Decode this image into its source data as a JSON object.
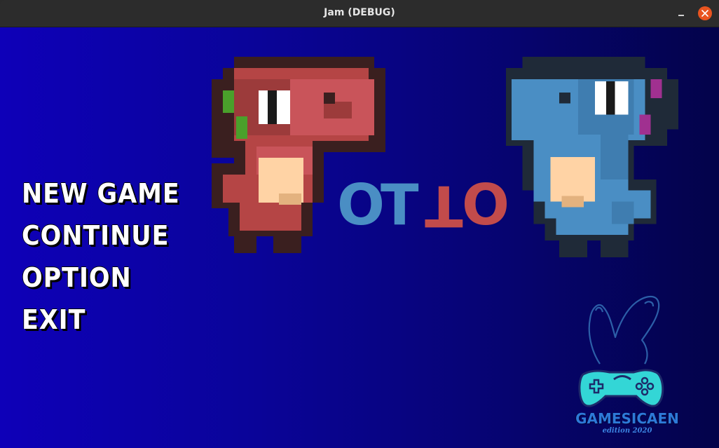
{
  "window": {
    "title": "Jam (DEBUG)",
    "minimize_icon": "minimize-icon",
    "close_icon": "close-icon",
    "close_color": "#e9541f"
  },
  "menu": {
    "items": [
      {
        "label": "NEW GAME"
      },
      {
        "label": "CONTINUE"
      },
      {
        "label": "OPTION"
      },
      {
        "label": "EXIT"
      }
    ]
  },
  "title_logo": {
    "letters": [
      {
        "char": "O",
        "color": "#4a8ec4"
      },
      {
        "char": "T",
        "color": "#4a8ec4"
      },
      {
        "char": "T",
        "color": "#c24b4b",
        "upside_down": true
      },
      {
        "char": "O",
        "color": "#c24b4b"
      }
    ]
  },
  "characters": [
    {
      "name": "red-dino",
      "color": "#c24b4b"
    },
    {
      "name": "blue-dino",
      "color": "#4a8ec4"
    }
  ],
  "jam_logo": {
    "name": "GAMESICAEN",
    "edition": "edition 2020",
    "icon": "bunny-gamepad-icon",
    "accent": "#33d6d6"
  },
  "colors": {
    "background_left": "#0e00b8",
    "background_right": "#03034a"
  }
}
